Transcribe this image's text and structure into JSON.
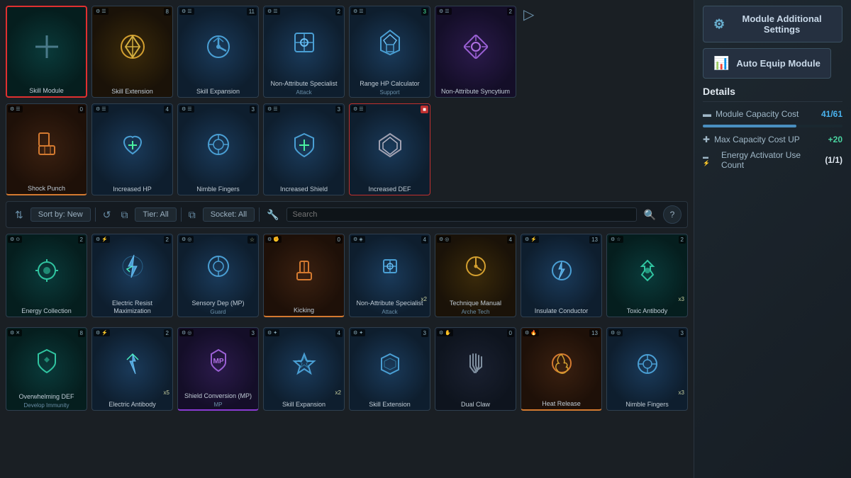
{
  "rightPanel": {
    "settingsBtn": "Module Additional Settings",
    "autoEquipBtn": "Auto Equip Module",
    "detailsTitle": "Details",
    "moduleCapacityLabel": "Module Capacity Cost",
    "moduleCapacityValue": "41/61",
    "moduleCapacityProgress": 67,
    "maxCapacityLabel": "Max Capacity Cost UP",
    "maxCapacityValue": "+20",
    "energyActivatorLabel": "Energy Activator Use Count",
    "energyActivatorValue": "(1/1)"
  },
  "filterBar": {
    "sortLabel": "Sort by: New",
    "refreshIcon": "↺",
    "tierLabel": "Tier: All",
    "socketLabel": "Socket: All",
    "searchPlaceholder": "Search",
    "searchIcon": "🔍",
    "helpIcon": "?"
  },
  "equippedModules": [
    {
      "id": "skill-module",
      "label": "Skill Module",
      "sublabel": "",
      "badge": "",
      "type": "empty",
      "selected": true
    },
    {
      "id": "skill-extension",
      "label": "Skill Extension",
      "sublabel": "",
      "badge": "8",
      "type": "gold"
    },
    {
      "id": "skill-expansion",
      "label": "Skill Expansion",
      "sublabel": "",
      "badge": "11",
      "type": "blue"
    },
    {
      "id": "non-attr-specialist",
      "label": "Non-Attribute Specialist",
      "sublabel": "Attack",
      "badge": "2",
      "type": "blue"
    },
    {
      "id": "range-hp-calc",
      "label": "Range HP Calculator",
      "sublabel": "Support",
      "badge": "3",
      "type": "blue"
    },
    {
      "id": "non-attr-syncytium",
      "label": "Non-Attribute Syncytium",
      "sublabel": "",
      "badge": "2",
      "type": "purple"
    }
  ],
  "equippedRow2": [
    {
      "id": "shock-punch",
      "label": "Shock Punch",
      "sublabel": "",
      "badge": "0",
      "type": "orange"
    },
    {
      "id": "increased-hp",
      "label": "Increased HP",
      "sublabel": "",
      "badge": "4",
      "type": "blue"
    },
    {
      "id": "nimble-fingers-eq",
      "label": "Nimble Fingers",
      "sublabel": "",
      "badge": "3",
      "type": "blue"
    },
    {
      "id": "increased-shield-eq",
      "label": "Increased Shield",
      "sublabel": "",
      "badge": "3",
      "type": "blue"
    },
    {
      "id": "increased-def-eq",
      "label": "Increased DEF",
      "sublabel": "",
      "badge": "red",
      "type": "blue"
    }
  ],
  "inventoryRow1": [
    {
      "id": "energy-collection",
      "label": "Energy Collection",
      "sublabel": "",
      "badge": "2",
      "type": "teal",
      "tl": "⊙"
    },
    {
      "id": "electric-resist-max",
      "label": "Electric Resist Maximization",
      "sublabel": "",
      "badge": "2",
      "type": "blue",
      "tl": "⚡"
    },
    {
      "id": "sensory-dep-mp",
      "label": "Sensory Dep (MP)",
      "sublabel": "Guard",
      "badge": "☆",
      "type": "blue",
      "tl": "◎"
    },
    {
      "id": "kicking",
      "label": "Kicking",
      "sublabel": "",
      "badge": "0",
      "type": "orange",
      "tl": "✊"
    },
    {
      "id": "non-attr-specialist-inv",
      "label": "Non-Attribute Specialist",
      "sublabel": "Attack",
      "badge": "4",
      "type": "blue",
      "tl": "◈",
      "x": "x2"
    },
    {
      "id": "technique-manual",
      "label": "Technique Manual",
      "sublabel": "Arche Tech",
      "badge": "4",
      "type": "gold",
      "tl": "◎"
    },
    {
      "id": "insulate-conductor",
      "label": "Insulate Conductor",
      "sublabel": "",
      "badge": "13",
      "type": "blue",
      "tl": "⚡"
    },
    {
      "id": "toxic-antibody",
      "label": "Toxic Antibody",
      "sublabel": "",
      "badge": "2",
      "type": "teal",
      "tl": "☆",
      "x": "x3"
    }
  ],
  "inventoryRow2": [
    {
      "id": "overwhelming-def",
      "label": "Overwhelming DEF",
      "sublabel": "Develop Immunity",
      "badge": "8",
      "type": "teal",
      "tl": "✕"
    },
    {
      "id": "electric-antibody",
      "label": "Electric Antibody",
      "sublabel": "",
      "badge": "2",
      "type": "blue",
      "tl": "⚡",
      "x": "x5"
    },
    {
      "id": "shield-conversion-mp",
      "label": "Shield Conversion (MP)",
      "sublabel": "MP",
      "badge": "3",
      "type": "purple",
      "tl": "◎"
    },
    {
      "id": "skill-expansion-inv",
      "label": "Skill Expansion",
      "sublabel": "",
      "badge": "4",
      "type": "blue",
      "tl": "✦",
      "x": "x2"
    },
    {
      "id": "skill-extension-inv",
      "label": "Skill Extension",
      "sublabel": "",
      "badge": "3",
      "type": "blue",
      "tl": "✦"
    },
    {
      "id": "dual-claw",
      "label": "Dual Claw",
      "sublabel": "",
      "badge": "0",
      "type": "dark",
      "tl": "✋"
    },
    {
      "id": "heat-release",
      "label": "Heat Release",
      "sublabel": "",
      "badge": "13",
      "type": "orange",
      "tl": "🔥"
    },
    {
      "id": "nimble-fingers-inv",
      "label": "Nimble Fingers",
      "sublabel": "",
      "badge": "3",
      "type": "blue",
      "tl": "◎",
      "x": "x3"
    }
  ]
}
